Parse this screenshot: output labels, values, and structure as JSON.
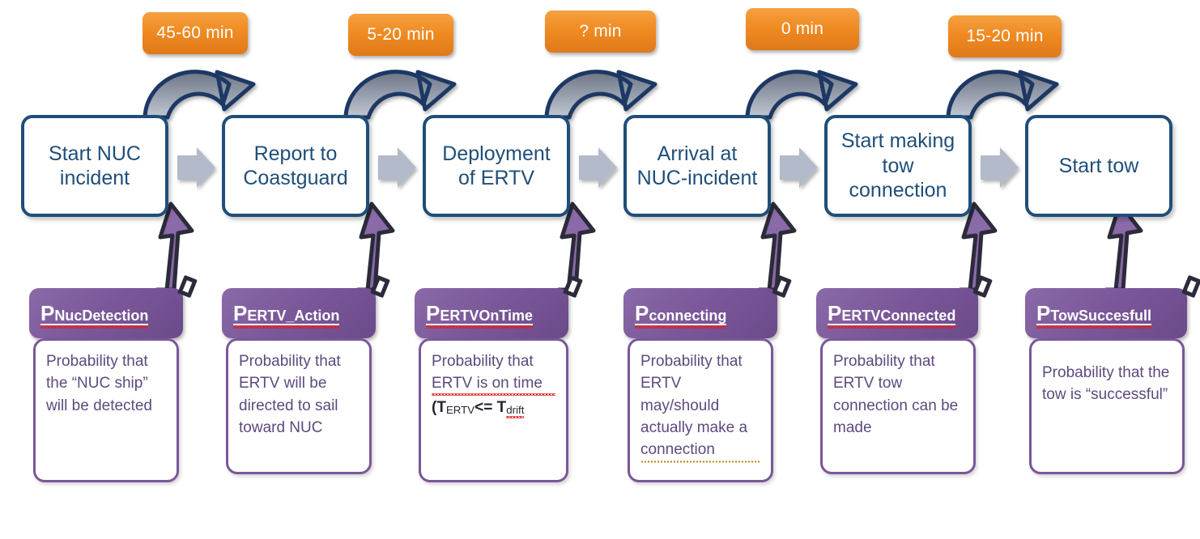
{
  "diagram": {
    "title": "ERTV NUC incident response timeline with probability nodes",
    "colors": {
      "process_border": "#1f4e79",
      "process_text": "#1f4e79",
      "time_badge": "#ef8b22",
      "time_badge_text": "#ffffff",
      "probability_header": "#7a5799",
      "probability_body_text": "#5d4a7e",
      "chevron": "#b3bac9",
      "arc_outline": "#1f3864",
      "arc_fill": "#9aa2b1",
      "purple_arrow": "#8a6aa8",
      "purple_arrow_outline": "#2b2b3a"
    },
    "time_badges": [
      {
        "id": "t1",
        "label": "45-60 min"
      },
      {
        "id": "t2",
        "label": "5-20 min"
      },
      {
        "id": "t3",
        "label": "? min"
      },
      {
        "id": "t4",
        "label": "0 min"
      },
      {
        "id": "t5",
        "label": "15-20 min"
      }
    ],
    "process_steps": [
      {
        "id": "p1",
        "label": "Start NUC incident"
      },
      {
        "id": "p2",
        "label": "Report to Coastguard"
      },
      {
        "id": "p3",
        "label": "Deployment of ERTV"
      },
      {
        "id": "p4",
        "label": "Arrival at NUC-incident"
      },
      {
        "id": "p5",
        "label": "Start making tow connection"
      },
      {
        "id": "p6",
        "label": "Start tow"
      }
    ],
    "probabilities": [
      {
        "id": "pr1",
        "symbol": "P",
        "subscript": "NucDetection",
        "full_label": "PNucDetection",
        "description": "Probability that the “NUC ship” will be detected"
      },
      {
        "id": "pr2",
        "symbol": "P",
        "subscript": "ERTV_Action",
        "full_label": "PERTV_Action",
        "description": "Probability that ERTV will be directed to sail toward NUC"
      },
      {
        "id": "pr3",
        "symbol": "P",
        "subscript": "ERTVOnTime",
        "full_label": "PERTVOnTime",
        "description": "Probability that ERTV is on time",
        "formula_prefix": "(T",
        "formula_sub1": "ERTV",
        "formula_op": "<= ",
        "formula_t2": "T",
        "formula_sub2": "drift"
      },
      {
        "id": "pr4",
        "symbol": "P",
        "subscript": "connecting",
        "full_label": "Pconnecting",
        "description": "Probability that ERTV may/should actually make a connection"
      },
      {
        "id": "pr5",
        "symbol": "P",
        "subscript": "ERTVConnected",
        "full_label": "PERTVConnected",
        "description": "Probability that ERTV tow connection can be made"
      },
      {
        "id": "pr6",
        "symbol": "P",
        "subscript": "TowSuccesfull",
        "full_label": "PTowSuccesfull",
        "description": "Probability that the tow is “successful”"
      }
    ]
  }
}
